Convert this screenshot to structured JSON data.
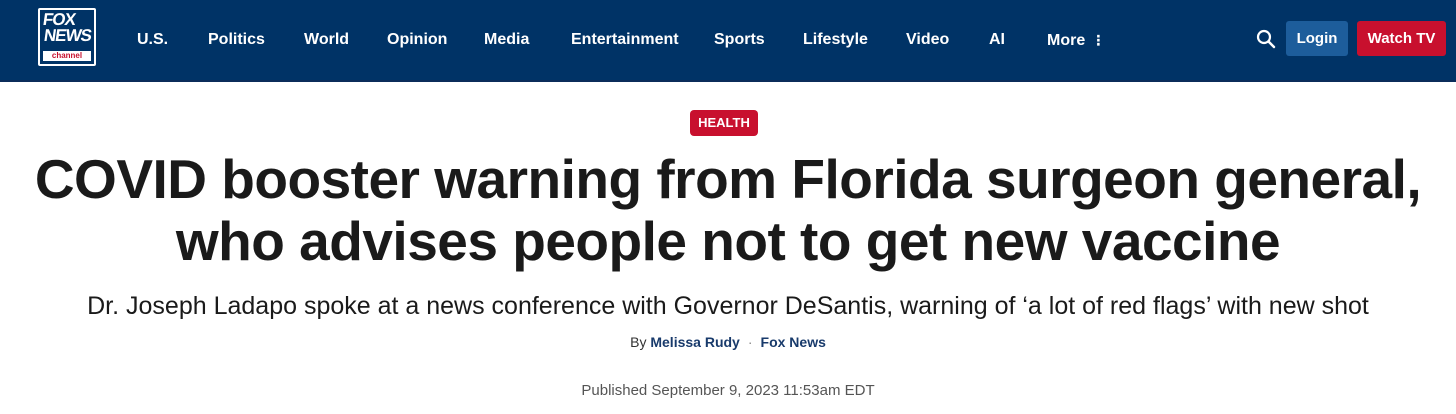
{
  "brand": {
    "logo_top": "FOX",
    "logo_mid": "NEWS",
    "logo_bottom": "channel",
    "navy": "#003366",
    "red": "#c8102e",
    "login_blue": "#1d5d9b"
  },
  "nav": {
    "items": [
      {
        "label": "U.S."
      },
      {
        "label": "Politics"
      },
      {
        "label": "World"
      },
      {
        "label": "Opinion"
      },
      {
        "label": "Media"
      },
      {
        "label": "Entertainment"
      },
      {
        "label": "Sports"
      },
      {
        "label": "Lifestyle"
      },
      {
        "label": "Video"
      },
      {
        "label": "AI"
      },
      {
        "label": "More"
      }
    ],
    "more_icon": "kebab-vertical-icon",
    "search_icon": "search-icon",
    "login_label": "Login",
    "watch_label": "Watch TV"
  },
  "article": {
    "eyebrow": "HEALTH",
    "headline_line1": "COVID booster warning from Florida surgeon general,",
    "headline_line2": "who advises people not to get new vaccine",
    "subhead": "Dr. Joseph Ladapo spoke at a news conference with Governor DeSantis, warning of ‘a lot of red flags’ with new shot",
    "byline_prefix": "By",
    "author": "Melissa Rudy",
    "separator": "·",
    "outlet": "Fox News",
    "published": "Published September 9, 2023 11:53am EDT"
  }
}
